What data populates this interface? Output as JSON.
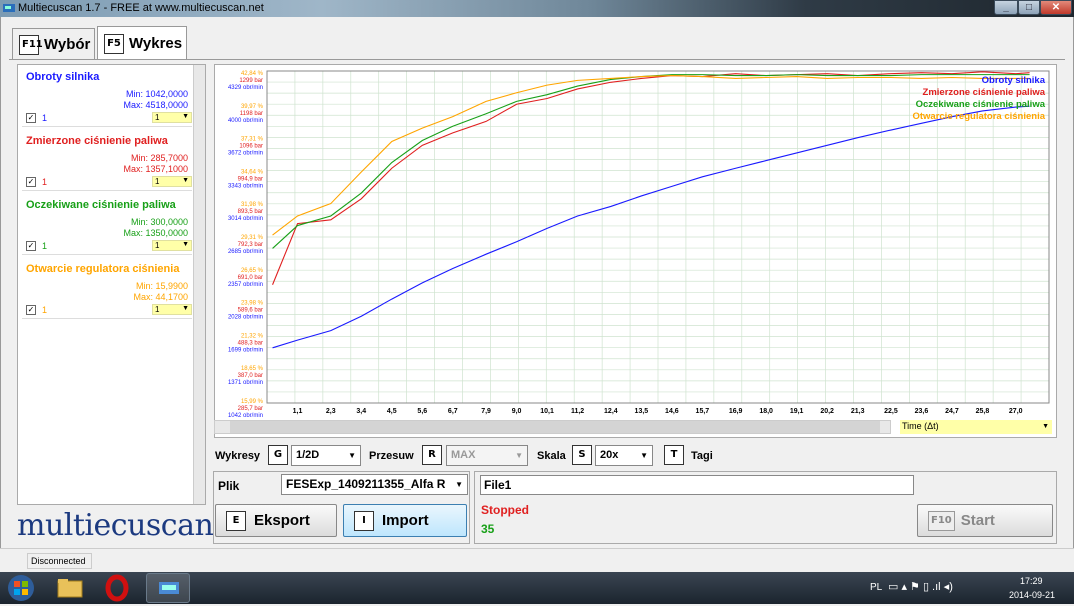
{
  "window": {
    "title": "Multiecuscan 1.7 - FREE at www.multiecuscan.net",
    "min_label": "_",
    "max_label": "□",
    "close_label": "✕"
  },
  "tabs": [
    {
      "key": "F11",
      "label": "Wybór"
    },
    {
      "key": "F5",
      "label": "Wykres"
    }
  ],
  "series": [
    {
      "name": "Obroty silnika",
      "min": "Min: 1042,0000",
      "max": "Max: 4518,0000",
      "num": "1",
      "sel": "1",
      "color": "#1a1aff"
    },
    {
      "name": "Zmierzone ciśnienie paliwa",
      "min": "Min: 285,7000",
      "max": "Max: 1357,1000",
      "num": "1",
      "sel": "1",
      "color": "#e02020"
    },
    {
      "name": "Oczekiwane ciśnienie paliwa",
      "min": "Min: 300,0000",
      "max": "Max: 1350,0000",
      "num": "1",
      "sel": "1",
      "color": "#18a018"
    },
    {
      "name": "Otwarcie regulatora ciśnienia",
      "min": "Min: 15,9900",
      "max": "Max: 44,1700",
      "num": "1",
      "sel": "1",
      "color": "#ffa500"
    }
  ],
  "logo": "multiecuscan",
  "chart_data": {
    "type": "line",
    "x": [
      0.2,
      1.1,
      2.3,
      3.4,
      4.5,
      5.6,
      6.7,
      7.9,
      9.0,
      10.1,
      11.2,
      12.4,
      13.5,
      14.6,
      15.7,
      16.9,
      18.0,
      19.1,
      20.2,
      21.3,
      22.5,
      23.6,
      24.7,
      25.8,
      27.0,
      27.5
    ],
    "xticks": [
      "1,1",
      "2,3",
      "3,4",
      "4,5",
      "5,6",
      "6,7",
      "7,9",
      "9,0",
      "10,1",
      "11,2",
      "12,4",
      "13,5",
      "14,6",
      "15,7",
      "16,9",
      "18,0",
      "19,1",
      "20,2",
      "21,3",
      "22,5",
      "23,6",
      "24,7",
      "25,8",
      "27,0"
    ],
    "y_tick_labels": [
      {
        "pct": "42,84 %",
        "bar": "1299 bar",
        "rpm": "4329 obr/min"
      },
      {
        "pct": "39,97 %",
        "bar": "1198 bar",
        "rpm": "4000 obr/min"
      },
      {
        "pct": "37,31 %",
        "bar": "1096 bar",
        "rpm": "3672 obr/min"
      },
      {
        "pct": "34,64 %",
        "bar": "994,9 bar",
        "rpm": "3343 obr/min"
      },
      {
        "pct": "31,98 %",
        "bar": "893,5 bar",
        "rpm": "3014 obr/min"
      },
      {
        "pct": "29,31 %",
        "bar": "792,3 bar",
        "rpm": "2685 obr/min"
      },
      {
        "pct": "26,65 %",
        "bar": "691,0 bar",
        "rpm": "2357 obr/min"
      },
      {
        "pct": "23,98 %",
        "bar": "589,6 bar",
        "rpm": "2028 obr/min"
      },
      {
        "pct": "21,32 %",
        "bar": "488,3 bar",
        "rpm": "1699 obr/min"
      },
      {
        "pct": "18,65 %",
        "bar": "387,0 bar",
        "rpm": "1371 obr/min"
      },
      {
        "pct": "15,99 %",
        "bar": "285,7 bar",
        "rpm": "1042 obr/min"
      }
    ],
    "ylim_rpm": [
      1042,
      4518
    ],
    "series": [
      {
        "name": "Obroty silnika",
        "color": "#1a1aff",
        "values": [
          1620,
          1700,
          1800,
          1950,
          2130,
          2300,
          2450,
          2600,
          2730,
          2870,
          3000,
          3100,
          3210,
          3310,
          3410,
          3500,
          3580,
          3660,
          3740,
          3820,
          3900,
          3970,
          4040,
          4100,
          4140,
          4150
        ]
      },
      {
        "name": "Zmierzone ciśnienie paliwa",
        "color": "#e02020",
        "values": [
          2280,
          2920,
          2960,
          3180,
          3500,
          3740,
          3870,
          3990,
          4170,
          4230,
          4330,
          4400,
          4440,
          4470,
          4460,
          4490,
          4470,
          4480,
          4490,
          4470,
          4490,
          4500,
          4490,
          4510,
          4490,
          4500
        ]
      },
      {
        "name": "Oczekiwane ciśnienie paliwa",
        "color": "#18a018",
        "values": [
          2660,
          2900,
          3000,
          3240,
          3560,
          3790,
          3940,
          4070,
          4200,
          4270,
          4360,
          4430,
          4460,
          4480,
          4480,
          4470,
          4470,
          4480,
          4470,
          4470,
          4470,
          4480,
          4480,
          4480,
          4480,
          4480
        ]
      },
      {
        "name": "Otwarcie regulatora ciśnienia",
        "color": "#ffa500",
        "values": [
          2800,
          3000,
          3130,
          3460,
          3780,
          3920,
          4040,
          4200,
          4290,
          4370,
          4420,
          4440,
          4460,
          4470,
          4460,
          4440,
          4450,
          4460,
          4440,
          4450,
          4450,
          4440,
          4450,
          4440,
          4440,
          4440
        ]
      }
    ],
    "grid": true,
    "legend_placement": "top-right"
  },
  "time_select": "Time (Δt)",
  "controls": {
    "wykresy_label": "Wykresy",
    "wykresy_key": "G",
    "wykresy_value": "1/2D",
    "przesuw_label": "Przesuw",
    "przesuw_key": "R",
    "przesuw_value": "MAX",
    "skala_label": "Skala",
    "skala_key": "S",
    "skala_value": "20x",
    "tagi_key": "T",
    "tagi_label": "Tagi"
  },
  "file": {
    "plik_label": "Plik",
    "plik_value": "FESExp_1409211355_Alfa R",
    "eksport_key": "E",
    "eksport_label": "Eksport",
    "import_key": "I",
    "import_label": "Import"
  },
  "status": {
    "file_name": "File1",
    "state": "Stopped",
    "count": "35",
    "start_key": "F10",
    "start_label": "Start"
  },
  "statusbar": {
    "connection": "Disconnected"
  },
  "taskbar": {
    "lang": "PL",
    "time": "17:29",
    "date": "2014-09-21"
  }
}
